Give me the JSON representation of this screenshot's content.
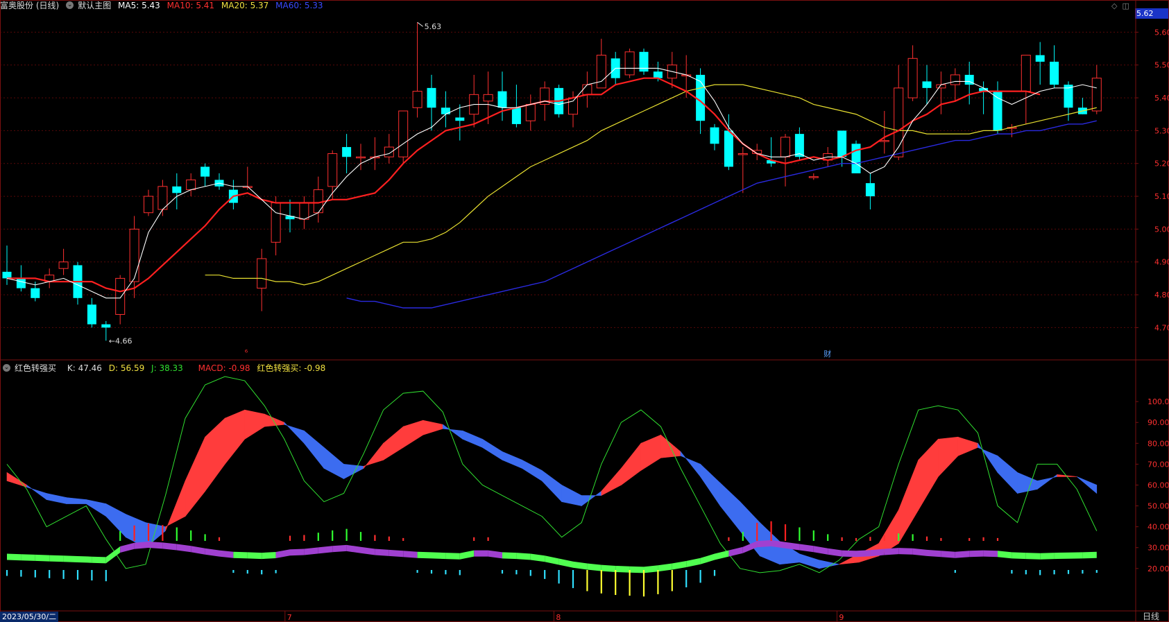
{
  "main_header": {
    "title": "富奥股份 (日线)",
    "chart_name": "默认主图",
    "ma5": "MA5: 5.43",
    "ma10": "MA10: 5.41",
    "ma20": "MA20: 5.37",
    "ma60": "MA60: 5.33"
  },
  "sub_header": {
    "indicator": "红色转强买",
    "k": "K: 47.46",
    "d": "D: 56.59",
    "j": "J: 38.33",
    "macd": "MACD: -0.98",
    "signal": "红色转强买: -0.98"
  },
  "current_price_tag": "5.62",
  "start_date": "2023/05/30/二",
  "period_label": "日线",
  "top_icons": [
    "diamond-icon",
    "window-icon"
  ],
  "colors": {
    "up": "#ff3030",
    "down": "#00ffff",
    "ma5": "#ffffff",
    "ma10": "#ff2020",
    "ma20": "#e8e030",
    "ma60": "#2a2ae0",
    "k": "#ff3030",
    "j": "#30e030",
    "band_up": "#ff3c3c",
    "band_down": "#3c6cf0",
    "macd_pos": "#a040d0",
    "macd_neg": "#50ff50",
    "grid": "#7a1010"
  },
  "chart_data": [
    {
      "type": "candlestick",
      "title": "富奥股份 (日线)",
      "y_ticks": [
        "5.60",
        "5.50",
        "5.40",
        "5.30",
        "5.20",
        "5.10",
        "5.00",
        "4.90",
        "4.80",
        "4.70"
      ],
      "ylim": [
        4.61,
        5.66
      ],
      "annotations": {
        "high": "5.63",
        "low": "4.66"
      },
      "event_markers": [
        "⁶",
        "财"
      ],
      "x_month_labels": [
        {
          "label": "7",
          "index": 20
        },
        {
          "label": "8",
          "index": 39
        },
        {
          "label": "9",
          "index": 59
        }
      ],
      "ohlc": [
        [
          4.87,
          4.95,
          4.83,
          4.85
        ],
        [
          4.85,
          4.89,
          4.81,
          4.82
        ],
        [
          4.82,
          4.84,
          4.78,
          4.79
        ],
        [
          4.84,
          4.88,
          4.82,
          4.86
        ],
        [
          4.88,
          4.94,
          4.86,
          4.9
        ],
        [
          4.89,
          4.9,
          4.77,
          4.79
        ],
        [
          4.77,
          4.79,
          4.7,
          4.71
        ],
        [
          4.71,
          4.72,
          4.66,
          4.7
        ],
        [
          4.74,
          4.86,
          4.71,
          4.85
        ],
        [
          4.84,
          5.04,
          4.79,
          5.0
        ],
        [
          5.05,
          5.12,
          5.04,
          5.1
        ],
        [
          5.06,
          5.15,
          5.04,
          5.13
        ],
        [
          5.13,
          5.17,
          5.06,
          5.11
        ],
        [
          5.12,
          5.17,
          5.1,
          5.15
        ],
        [
          5.19,
          5.2,
          5.13,
          5.16
        ],
        [
          5.15,
          5.17,
          5.12,
          5.13
        ],
        [
          5.12,
          5.15,
          5.06,
          5.08
        ],
        [
          5.13,
          5.19,
          5.12,
          5.13
        ],
        [
          4.82,
          4.94,
          4.75,
          4.91
        ],
        [
          4.96,
          5.1,
          4.92,
          5.08
        ],
        [
          5.04,
          5.09,
          4.99,
          5.03
        ],
        [
          5.03,
          5.1,
          5.0,
          5.08
        ],
        [
          5.05,
          5.16,
          5.02,
          5.12
        ],
        [
          5.13,
          5.24,
          5.09,
          5.23
        ],
        [
          5.25,
          5.29,
          5.17,
          5.22
        ],
        [
          5.22,
          5.26,
          5.18,
          5.22
        ],
        [
          5.22,
          5.28,
          5.18,
          5.22
        ],
        [
          5.22,
          5.29,
          5.2,
          5.25
        ],
        [
          5.22,
          5.36,
          5.2,
          5.36
        ],
        [
          5.37,
          5.63,
          5.34,
          5.42
        ],
        [
          5.43,
          5.47,
          5.3,
          5.37
        ],
        [
          5.37,
          5.42,
          5.31,
          5.35
        ],
        [
          5.34,
          5.38,
          5.27,
          5.33
        ],
        [
          5.35,
          5.47,
          5.31,
          5.41
        ],
        [
          5.39,
          5.48,
          5.32,
          5.41
        ],
        [
          5.42,
          5.48,
          5.33,
          5.37
        ],
        [
          5.37,
          5.44,
          5.31,
          5.32
        ],
        [
          5.33,
          5.41,
          5.3,
          5.38
        ],
        [
          5.38,
          5.45,
          5.33,
          5.43
        ],
        [
          5.43,
          5.44,
          5.34,
          5.35
        ],
        [
          5.35,
          5.42,
          5.31,
          5.4
        ],
        [
          5.41,
          5.48,
          5.37,
          5.44
        ],
        [
          5.43,
          5.58,
          5.43,
          5.53
        ],
        [
          5.52,
          5.54,
          5.44,
          5.46
        ],
        [
          5.47,
          5.55,
          5.46,
          5.54
        ],
        [
          5.54,
          5.55,
          5.47,
          5.48
        ],
        [
          5.48,
          5.51,
          5.45,
          5.46
        ],
        [
          5.46,
          5.54,
          5.43,
          5.5
        ],
        [
          5.47,
          5.53,
          5.4,
          5.47
        ],
        [
          5.47,
          5.49,
          5.29,
          5.33
        ],
        [
          5.31,
          5.32,
          5.24,
          5.26
        ],
        [
          5.3,
          5.35,
          5.18,
          5.19
        ],
        [
          5.23,
          5.25,
          5.11,
          5.23
        ],
        [
          5.23,
          5.26,
          5.21,
          5.24
        ],
        [
          5.21,
          5.28,
          5.19,
          5.2
        ],
        [
          5.22,
          5.29,
          5.13,
          5.28
        ],
        [
          5.29,
          5.31,
          5.21,
          5.22
        ],
        [
          5.16,
          5.17,
          5.15,
          5.16
        ],
        [
          5.21,
          5.25,
          5.19,
          5.23
        ],
        [
          5.3,
          5.3,
          5.19,
          5.22
        ],
        [
          5.26,
          5.27,
          5.18,
          5.17
        ],
        [
          5.14,
          5.17,
          5.06,
          5.1
        ],
        [
          5.27,
          5.36,
          5.23,
          5.27
        ],
        [
          5.22,
          5.5,
          5.21,
          5.43
        ],
        [
          5.4,
          5.56,
          5.39,
          5.52
        ],
        [
          5.45,
          5.5,
          5.38,
          5.43
        ],
        [
          5.43,
          5.48,
          5.35,
          5.44
        ],
        [
          5.44,
          5.49,
          5.39,
          5.47
        ],
        [
          5.47,
          5.51,
          5.38,
          5.44
        ],
        [
          5.43,
          5.45,
          5.35,
          5.42
        ],
        [
          5.42,
          5.45,
          5.29,
          5.3
        ],
        [
          5.31,
          5.32,
          5.28,
          5.31
        ],
        [
          5.42,
          5.53,
          5.32,
          5.53
        ],
        [
          5.53,
          5.57,
          5.44,
          5.51
        ],
        [
          5.51,
          5.56,
          5.43,
          5.44
        ],
        [
          5.44,
          5.45,
          5.33,
          5.37
        ],
        [
          5.37,
          5.4,
          5.35,
          5.35
        ],
        [
          5.36,
          5.5,
          5.35,
          5.46
        ]
      ],
      "ma5": [
        4.85,
        4.84,
        4.83,
        4.84,
        4.85,
        4.83,
        4.81,
        4.79,
        4.79,
        4.85,
        4.99,
        5.06,
        5.1,
        5.12,
        5.13,
        5.14,
        5.13,
        5.13,
        5.09,
        5.05,
        5.04,
        5.03,
        5.05,
        5.11,
        5.16,
        5.2,
        5.22,
        5.23,
        5.26,
        5.29,
        5.31,
        5.35,
        5.37,
        5.38,
        5.38,
        5.37,
        5.37,
        5.38,
        5.39,
        5.38,
        5.39,
        5.44,
        5.45,
        5.49,
        5.49,
        5.49,
        5.49,
        5.48,
        5.47,
        5.45,
        5.39,
        5.31,
        5.26,
        5.23,
        5.22,
        5.22,
        5.23,
        5.21,
        5.22,
        5.22,
        5.2,
        5.17,
        5.19,
        5.25,
        5.33,
        5.38,
        5.44,
        5.45,
        5.45,
        5.43,
        5.4,
        5.38,
        5.4,
        5.42,
        5.43,
        5.43,
        5.44,
        5.43
      ],
      "ma10": [
        4.85,
        4.85,
        4.85,
        4.84,
        4.84,
        4.84,
        4.84,
        4.82,
        4.81,
        4.82,
        4.85,
        4.89,
        4.93,
        4.97,
        5.01,
        5.06,
        5.1,
        5.11,
        5.09,
        5.08,
        5.08,
        5.08,
        5.08,
        5.09,
        5.09,
        5.1,
        5.11,
        5.15,
        5.2,
        5.24,
        5.27,
        5.3,
        5.31,
        5.32,
        5.34,
        5.36,
        5.37,
        5.38,
        5.39,
        5.39,
        5.4,
        5.41,
        5.41,
        5.44,
        5.45,
        5.46,
        5.46,
        5.44,
        5.42,
        5.39,
        5.35,
        5.3,
        5.26,
        5.23,
        5.21,
        5.2,
        5.21,
        5.22,
        5.21,
        5.22,
        5.24,
        5.25,
        5.28,
        5.3,
        5.33,
        5.35,
        5.38,
        5.39,
        5.41,
        5.42,
        5.42,
        5.42,
        5.42,
        5.41
      ],
      "ma20": [
        4.86,
        4.86,
        4.85,
        4.85,
        4.85,
        4.84,
        4.84,
        4.83,
        4.84,
        4.86,
        4.88,
        4.9,
        4.92,
        4.94,
        4.96,
        4.96,
        4.97,
        4.99,
        5.02,
        5.06,
        5.1,
        5.13,
        5.16,
        5.19,
        5.21,
        5.23,
        5.25,
        5.27,
        5.3,
        5.32,
        5.34,
        5.36,
        5.38,
        5.4,
        5.42,
        5.43,
        5.44,
        5.44,
        5.44,
        5.43,
        5.42,
        5.41,
        5.4,
        5.38,
        5.37,
        5.36,
        5.35,
        5.33,
        5.31,
        5.3,
        5.3,
        5.29,
        5.29,
        5.29,
        5.29,
        5.3,
        5.3,
        5.31,
        5.32,
        5.33,
        5.34,
        5.35,
        5.36,
        5.37
      ],
      "ma60": [
        4.79,
        4.78,
        4.78,
        4.77,
        4.76,
        4.76,
        4.76,
        4.77,
        4.78,
        4.79,
        4.8,
        4.81,
        4.82,
        4.83,
        4.84,
        4.86,
        4.88,
        4.9,
        4.92,
        4.94,
        4.96,
        4.98,
        5.0,
        5.02,
        5.04,
        5.06,
        5.08,
        5.1,
        5.12,
        5.14,
        5.15,
        5.16,
        5.17,
        5.18,
        5.19,
        5.2,
        5.2,
        5.21,
        5.22,
        5.23,
        5.24,
        5.25,
        5.26,
        5.27,
        5.27,
        5.28,
        5.29,
        5.29,
        5.3,
        5.3,
        5.31,
        5.32,
        5.32,
        5.33
      ],
      "ma20_start_index": 14,
      "ma60_start_index": 24
    },
    {
      "type": "indicator",
      "title": "红色转强买",
      "y_ticks": [
        "100.00",
        "90.00",
        "80.00",
        "70.00",
        "60.00",
        "50.00",
        "40.00",
        "30.00",
        "20.00"
      ],
      "ylim": [
        0,
        113
      ],
      "k": [
        66,
        60,
        53,
        51,
        51,
        45,
        35,
        30,
        38,
        62,
        83,
        92,
        96,
        94,
        90,
        80,
        68,
        63,
        68,
        80,
        88,
        91,
        89,
        82,
        78,
        72,
        68,
        62,
        52,
        50,
        57,
        68,
        80,
        84,
        76,
        64,
        50,
        38,
        26,
        22,
        23,
        20,
        22,
        27,
        32,
        48,
        72,
        82,
        83,
        80,
        66,
        56,
        58,
        65,
        64,
        56
      ],
      "d": [
        62,
        59,
        56,
        54,
        53,
        51,
        46,
        42,
        40,
        45,
        57,
        70,
        82,
        88,
        89,
        86,
        78,
        70,
        69,
        72,
        78,
        84,
        87,
        86,
        82,
        76,
        72,
        67,
        60,
        55,
        55,
        60,
        67,
        73,
        74,
        70,
        61,
        52,
        42,
        33,
        27,
        24,
        22,
        23,
        26,
        32,
        48,
        64,
        74,
        78,
        74,
        66,
        62,
        64,
        64,
        60
      ],
      "j": [
        70,
        58,
        40,
        45,
        50,
        34,
        20,
        22,
        55,
        92,
        108,
        112,
        110,
        98,
        82,
        62,
        52,
        56,
        75,
        96,
        104,
        105,
        95,
        70,
        60,
        55,
        50,
        45,
        35,
        42,
        70,
        90,
        96,
        88,
        68,
        50,
        32,
        20,
        18,
        19,
        22,
        18,
        24,
        34,
        40,
        70,
        96,
        98,
        96,
        85,
        50,
        42,
        70,
        70,
        58,
        38
      ],
      "macd": [
        -0.1,
        -0.12,
        -0.14,
        -0.16,
        -0.18,
        -0.2,
        -0.22,
        -0.24,
        0.2,
        0.35,
        0.4,
        0.36,
        0.3,
        0.22,
        0.12,
        0.04,
        -0.02,
        -0.04,
        -0.06,
        -0.03,
        0.08,
        0.1,
        0.16,
        0.22,
        0.26,
        0.18,
        0.1,
        0.06,
        0.02,
        -0.02,
        -0.04,
        -0.06,
        -0.08,
        0.04,
        0.04,
        -0.04,
        -0.06,
        -0.1,
        -0.18,
        -0.3,
        -0.42,
        -0.5,
        -0.56,
        -0.6,
        -0.62,
        -0.64,
        -0.58,
        -0.5,
        -0.4,
        -0.28,
        -0.1,
        0.04,
        0.18,
        0.42,
        0.46,
        0.38,
        0.3,
        0.22,
        0.12,
        0.04,
        0.02,
        0.05,
        0.1,
        0.14,
        0.12,
        0.06,
        0.02,
        -0.02,
        0.02,
        0.04,
        0.02,
        -0.04,
        -0.06,
        -0.08,
        -0.06,
        -0.05,
        -0.04,
        -0.02
      ]
    }
  ]
}
